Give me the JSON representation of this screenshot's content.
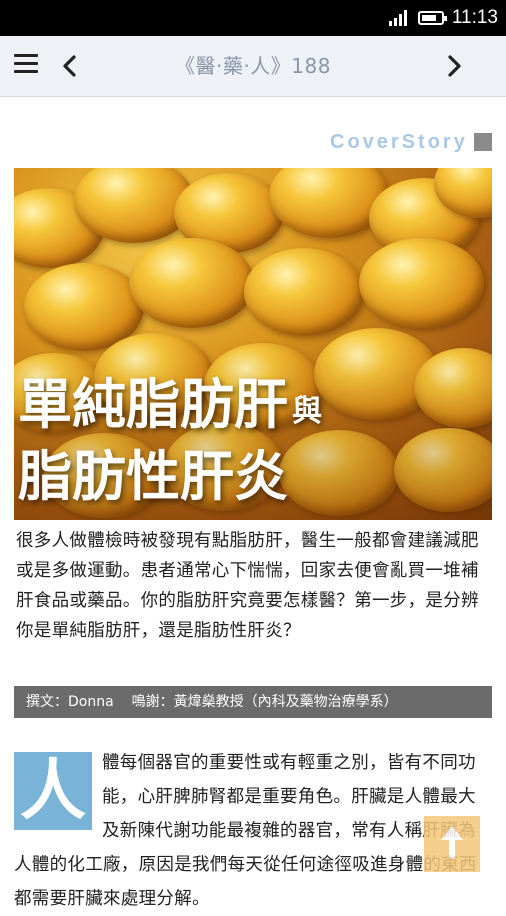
{
  "status_bar": {
    "time": "11:13"
  },
  "app_bar": {
    "title": "《醫‧藥‧人》188"
  },
  "article": {
    "section_label": "CoverStory",
    "hero_title_line1": "單純脂肪肝",
    "hero_title_conjunction": "與",
    "hero_title_line2": "脂肪性肝炎",
    "intro": "很多人做體檢時被發現有點脂肪肝，醫生一般都會建議減肥或是多做運動。患者通常心下惴惴，回家去便會亂買一堆補肝食品或藥品。你的脂肪肝究竟要怎樣醫？第一步，是分辨你是單純脂肪肝，還是脂肪性肝炎？",
    "credit_author": "撰文：Donna",
    "credit_thanks": "鳴謝：黃煒燊教授（內科及藥物治療學系）",
    "dropcap": "人",
    "body": "體每個器官的重要性或有輕重之別，皆有不同功能，心肝脾肺腎都是重要角色。肝臟是人體最大及新陳代謝功能最複雜的器官，常有人稱肝臟為人體的化工廠，原因是我們每天從任何途徑吸進身體的東西都需要肝臟來處理分解。"
  },
  "icons": {
    "menu": "hamburger-menu-icon",
    "prev": "chevron-left-icon",
    "next": "chevron-right-icon",
    "scroll_top": "arrow-up-icon"
  },
  "colors": {
    "accent_blue": "#79b4d8",
    "credit_bar": "#6b6b6b",
    "app_bar_bg": "#eef1f6",
    "scroll_badge": "#f5c77a"
  }
}
